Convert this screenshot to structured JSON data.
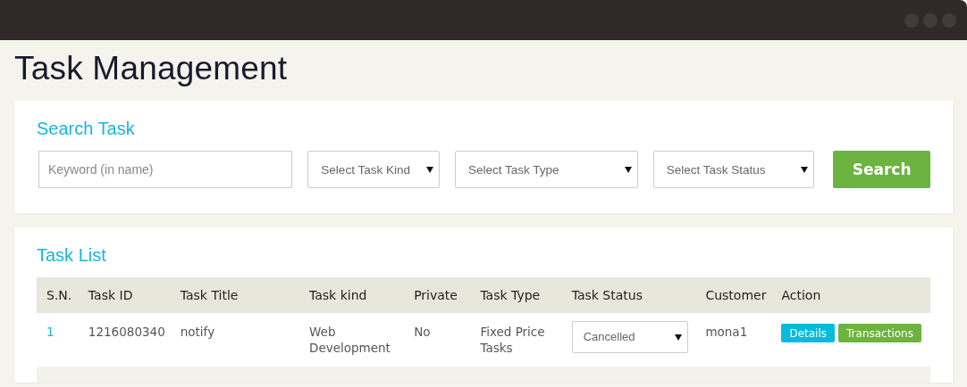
{
  "page_title": "Task Management",
  "search": {
    "title": "Search Task",
    "keyword": {
      "placeholder": "Keyword (in name)"
    },
    "selects": [
      {
        "placeholder": "Select Task Kind"
      },
      {
        "placeholder": "Select Task Type"
      },
      {
        "placeholder": "Select Task Status"
      }
    ],
    "button": "Search"
  },
  "task_list": {
    "title": "Task List",
    "columns": [
      "S.N.",
      "Task ID",
      "Task Title",
      "Task kind",
      "Private",
      "Task Type",
      "Task Status",
      "Customer",
      "Action"
    ],
    "rows": [
      {
        "sn": "1",
        "task_id": "1216080340",
        "title": "notify",
        "kind": "Web Development",
        "private": "No",
        "type": "Fixed Price Tasks",
        "status": "Cancelled",
        "customer": "mona1",
        "actions": [
          "Details",
          "Transactions"
        ]
      }
    ]
  }
}
